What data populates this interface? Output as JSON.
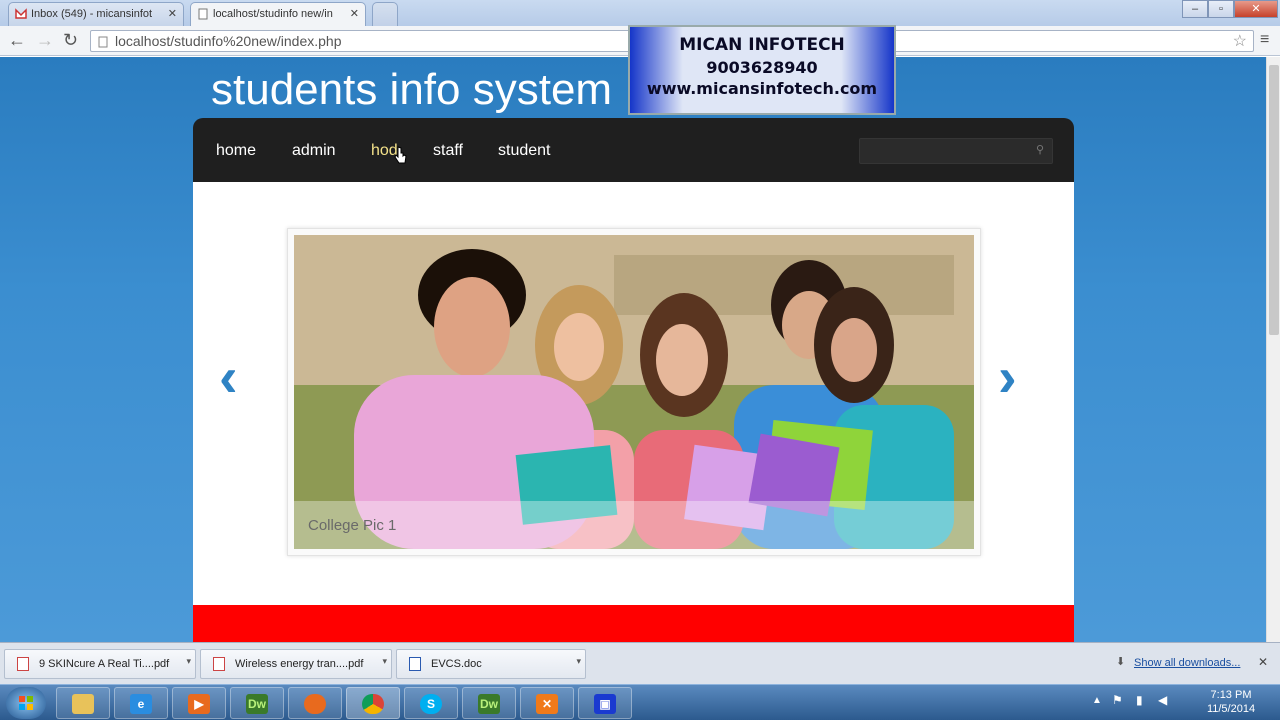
{
  "browser": {
    "tabs": [
      {
        "label": "Inbox (549) - micansinfot",
        "active": false
      },
      {
        "label": "localhost/studinfo new/in",
        "active": true
      }
    ],
    "url": "localhost/studinfo%20new/index.php"
  },
  "site": {
    "title": "students info system",
    "menu": [
      "home",
      "admin",
      "hod",
      "staff",
      "student"
    ],
    "search_placeholder": "",
    "slide_caption": "College Pic 1"
  },
  "watermark": {
    "company": "MICAN INFOTECH",
    "phone": "9003628940",
    "website": "www.micansinfotech.com"
  },
  "downloads": {
    "items": [
      "9 SKINcure A Real Ti....pdf",
      "Wireless energy tran....pdf",
      "EVCS.doc"
    ],
    "show_all": "Show all downloads..."
  },
  "taskbar": {
    "time": "7:13 PM",
    "date": "11/5/2014",
    "apps": [
      "folder-icon",
      "ie-icon",
      "media-player-icon",
      "dreamweaver-icon",
      "firefox-icon",
      "chrome-icon",
      "skype-icon",
      "dreamweaver-icon",
      "xampp-icon",
      "remote-app-icon"
    ]
  }
}
